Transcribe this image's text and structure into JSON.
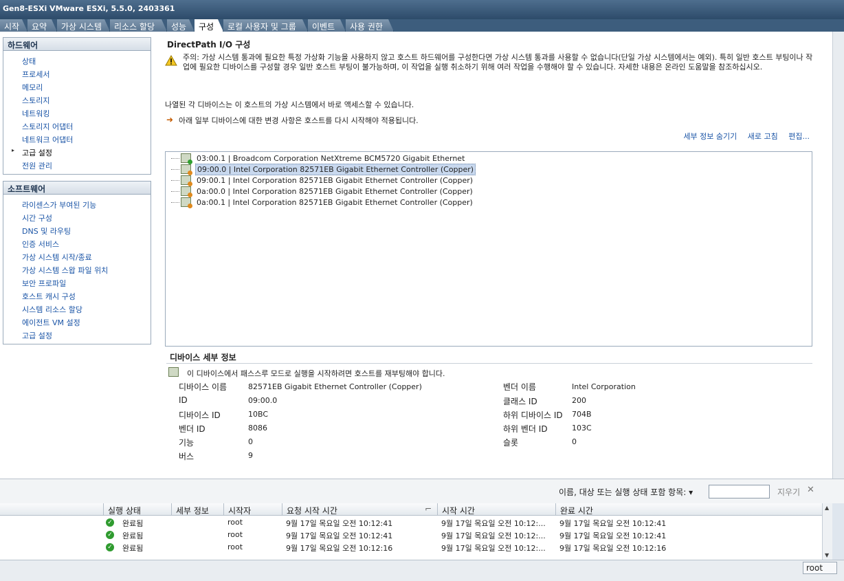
{
  "window": {
    "title": "Gen8-ESXi VMware ESXi, 5.5.0, 2403361"
  },
  "tabs": [
    "시작",
    "요약",
    "가상 시스템",
    "리소스 할당",
    "성능",
    "구성",
    "로컬 사용자 및 그룹",
    "이벤트",
    "사용 권한"
  ],
  "hardware_panel": {
    "title": "하드웨어",
    "items": [
      "상태",
      "프로세서",
      "메모리",
      "스토리지",
      "네트워킹",
      "스토리지 어댑터",
      "네트워크 어댑터",
      "고급 설정",
      "전원 관리"
    ]
  },
  "software_panel": {
    "title": "소프트웨어",
    "items": [
      "라이센스가 부여된 기능",
      "시간 구성",
      "DNS 및 라우팅",
      "인증 서비스",
      "가상 시스템 시작/종료",
      "가상 시스템 스왑 파일 위치",
      "보안 프로파일",
      "호스트 캐시 구성",
      "시스템 리소스 할당",
      "에이전트 VM 설정",
      "고급 설정"
    ]
  },
  "directpath": {
    "title": "DirectPath I/O 구성",
    "warning": "주의: 가상 시스템 통과에 필요한 특정 가상화 기능을 사용하지 않고 호스트 하드웨어를 구성한다면 가상 시스템 통과를 사용할 수 없습니다(단일 가상 시스템에서는 예외). 특히 일반 호스트 부팅이나 작업에 필요한 디바이스를 구성할 경우 일반 호스트 부팅이 불가능하며, 이 작업을 실행 취소하기 위해 여러 작업을 수행해야 할 수 있습니다. 자세한 내용은 온라인 도움말을 참조하십시오.",
    "intro": "나열된 각 디바이스는 이 호스트의 가상 시스템에서 바로 액세스할 수 있습니다.",
    "reboot_note": "아래 일부 디바이스에 대한 변경 사항은 호스트를 다시 시작해야 적용됩니다.",
    "actions": {
      "hide_details": "세부 정보 숨기기",
      "refresh": "새로 고침",
      "edit": "편집..."
    },
    "devices": [
      "03:00.1 | Broadcom Corporation NetXtreme BCM5720 Gigabit Ethernet",
      "09:00.0 | Intel Corporation 82571EB Gigabit Ethernet Controller (Copper)",
      "09:00.1 | Intel Corporation 82571EB Gigabit Ethernet Controller (Copper)",
      "0a:00.0 | Intel Corporation 82571EB Gigabit Ethernet Controller (Copper)",
      "0a:00.1 | Intel Corporation 82571EB Gigabit Ethernet Controller (Copper)"
    ],
    "selected_device_index": 1
  },
  "device_details": {
    "title": "디바이스 세부 정보",
    "note": "이 디바이스에서 패스스루 모드로 실행을 시작하려면 호스트를 재부팅해야 합니다.",
    "left": [
      {
        "label": "디바이스 이름",
        "value": "82571EB Gigabit Ethernet Controller (Copper)"
      },
      {
        "label": "ID",
        "value": "09:00.0"
      },
      {
        "label": "디바이스 ID",
        "value": "10BC"
      },
      {
        "label": "벤더 ID",
        "value": "8086"
      },
      {
        "label": "기능",
        "value": "0"
      },
      {
        "label": "버스",
        "value": "9"
      }
    ],
    "right": [
      {
        "label": "벤더 이름",
        "value": "Intel Corporation"
      },
      {
        "label": "클래스 ID",
        "value": "200"
      },
      {
        "label": "하위 디바이스 ID",
        "value": "704B"
      },
      {
        "label": "하위 벤더 ID",
        "value": "103C"
      },
      {
        "label": "슬롯",
        "value": "0"
      }
    ]
  },
  "tasks": {
    "filter_label": "이름, 대상 또는 실행 상태 포함 항목: ▾",
    "filter_value": "",
    "clear": "지우기",
    "columns": [
      "실행 상태",
      "세부 정보",
      "시작자",
      "요청 시작 시간",
      "시작 시간",
      "완료 시간"
    ],
    "rows": [
      {
        "status": "완료됨",
        "initiator": "root",
        "requested": "9월 17일 목요일 오전 10:12:41",
        "started": "9월 17일 목요일 오전 10:12:...",
        "completed": "9월 17일 목요일 오전 10:12:41"
      },
      {
        "status": "완료됨",
        "initiator": "root",
        "requested": "9월 17일 목요일 오전 10:12:41",
        "started": "9월 17일 목요일 오전 10:12:...",
        "completed": "9월 17일 목요일 오전 10:12:41"
      },
      {
        "status": "완료됨",
        "initiator": "root",
        "requested": "9월 17일 목요일 오전 10:12:16",
        "started": "9월 17일 목요일 오전 10:12:...",
        "completed": "9월 17일 목요일 오전 10:12:16"
      }
    ]
  },
  "statusbar": {
    "user": "root"
  }
}
